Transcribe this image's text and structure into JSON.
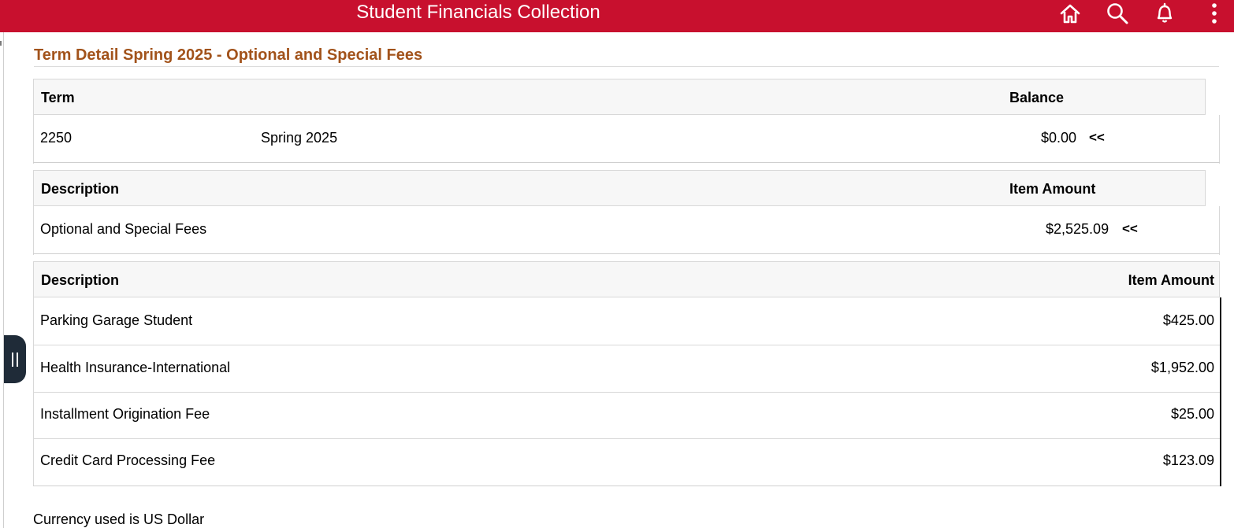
{
  "header": {
    "title": "Student Financials Collection",
    "icons": [
      "home-icon",
      "search-icon",
      "notifications-icon",
      "more-options-icon"
    ]
  },
  "page": {
    "title": "Term Detail Spring 2025 - Optional and Special Fees"
  },
  "term_grid": {
    "headers": {
      "term": "Term",
      "balance": "Balance"
    },
    "row": {
      "code": "2250",
      "name": "Spring 2025",
      "balance": "$0.00",
      "collapse": "<<"
    }
  },
  "category_grid": {
    "headers": {
      "description": "Description",
      "amount": "Item Amount"
    },
    "row": {
      "description": "Optional and Special Fees",
      "amount": "$2,525.09",
      "collapse": "<<"
    }
  },
  "items_grid": {
    "headers": {
      "description": "Description",
      "amount": "Item Amount"
    },
    "rows": [
      {
        "description": "Parking Garage Student",
        "amount": "$425.00"
      },
      {
        "description": "Health Insurance-International",
        "amount": "$1,952.00"
      },
      {
        "description": "Installment Origination Fee",
        "amount": "$25.00"
      },
      {
        "description": "Credit Card Processing Fee",
        "amount": "$123.09"
      }
    ]
  },
  "footer": {
    "currency_note": "Currency used is US Dollar"
  },
  "colors": {
    "header_bg": "#c8102e",
    "title": "#a2531b",
    "grid_header_bg": "#f7f7f7"
  }
}
